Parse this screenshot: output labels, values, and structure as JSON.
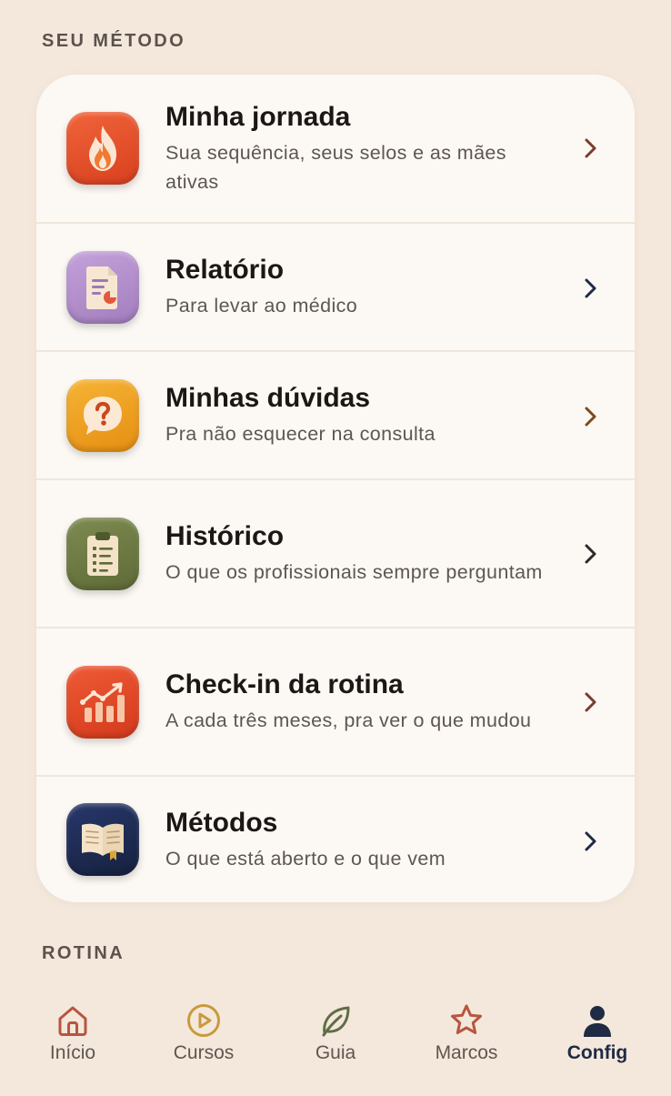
{
  "sections": {
    "method_title": "SEU MÉTODO",
    "routine_title": "ROTINA"
  },
  "menu": {
    "items": [
      {
        "title": "Minha jornada",
        "subtitle": "Sua sequência, seus selos e as mães ativas",
        "icon": "flame-icon",
        "icon_color": "#e5502e",
        "chevron_color": "#7a3b2e"
      },
      {
        "title": "Relatório",
        "subtitle": "Para levar ao médico",
        "icon": "document-icon",
        "icon_color": "#b18fc9",
        "chevron_color": "#1f2a44"
      },
      {
        "title": "Minhas dúvidas",
        "subtitle": "Pra não esquecer na consulta",
        "icon": "question-bubble-icon",
        "icon_color": "#f0a21f",
        "chevron_color": "#7a4a1e"
      },
      {
        "title": "Histórico",
        "subtitle": "O que os profissionais sempre perguntam",
        "icon": "clipboard-icon",
        "icon_color": "#6e7b43",
        "chevron_color": "#2a2a2a"
      },
      {
        "title": "Check-in da rotina",
        "subtitle": "A cada três meses, pra ver o que mudou",
        "icon": "growth-chart-icon",
        "icon_color": "#e4492a",
        "chevron_color": "#7a3b2e"
      },
      {
        "title": "Métodos",
        "subtitle": "O que está aberto e o que vem",
        "icon": "open-book-icon",
        "icon_color": "#1f2d52",
        "chevron_color": "#1f2a44"
      }
    ]
  },
  "tabbar": {
    "items": [
      {
        "label": "Início",
        "icon": "home-icon",
        "color": "#b8553f",
        "active": false
      },
      {
        "label": "Cursos",
        "icon": "play-circle-icon",
        "color": "#c99a3a",
        "active": false
      },
      {
        "label": "Guia",
        "icon": "leaf-icon",
        "color": "#5f6d44",
        "active": false
      },
      {
        "label": "Marcos",
        "icon": "star-icon",
        "color": "#b8553f",
        "active": false
      },
      {
        "label": "Config",
        "icon": "person-icon",
        "color": "#1f2a44",
        "active": true
      }
    ]
  }
}
